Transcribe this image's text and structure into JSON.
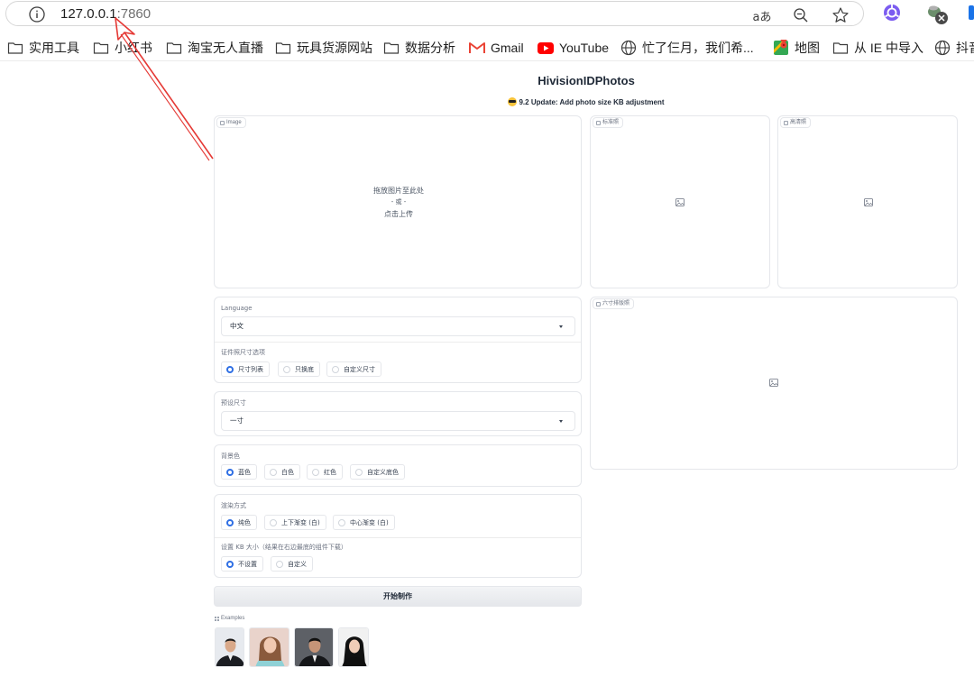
{
  "browser": {
    "url_host": "127.0.0.1",
    "url_port": ":7860",
    "translate_label": "aあ",
    "ext_badge": "X"
  },
  "bookmarks": [
    {
      "label": "实用工具",
      "icon": "folder-icon"
    },
    {
      "label": "小红书",
      "icon": "folder-icon"
    },
    {
      "label": "淘宝无人直播",
      "icon": "folder-icon"
    },
    {
      "label": "玩具货源网站",
      "icon": "folder-icon"
    },
    {
      "label": "数据分析",
      "icon": "folder-icon"
    },
    {
      "label": "Gmail",
      "icon": "gmail-icon"
    },
    {
      "label": "YouTube",
      "icon": "youtube-icon"
    },
    {
      "label": "忙了仨月，我们希...",
      "icon": "globe-icon"
    },
    {
      "label": "地图",
      "icon": "maps-icon"
    },
    {
      "label": "从 IE 中导入",
      "icon": "folder-icon"
    },
    {
      "label": "抖音",
      "icon": "globe-icon"
    }
  ],
  "app": {
    "title": "HivisionIDPhotos",
    "subtitle": "9.2 Update: Add photo size KB adjustment"
  },
  "image_input": {
    "tag": "Image",
    "line1": "拖放图片至此处",
    "line2": "- 或 -",
    "line3": "点击上传"
  },
  "outputs": {
    "standard_tag": "标准照",
    "hd_tag": "高清照",
    "layout_tag": "六寸排版照"
  },
  "form": {
    "language_label": "Language",
    "language_value": "中文",
    "size_option_label": "证件照尺寸选项",
    "size_options": [
      "尺寸列表",
      "只换底",
      "自定义尺寸"
    ],
    "size_selected": 0,
    "preset_label": "预设尺寸",
    "preset_value": "一寸",
    "bg_label": "背景色",
    "bg_options": [
      "蓝色",
      "白色",
      "红色",
      "自定义底色"
    ],
    "bg_selected": 0,
    "render_label": "渲染方式",
    "render_options": [
      "纯色",
      "上下渐变 (白)",
      "中心渐变 (白)"
    ],
    "render_selected": 0,
    "kb_label": "设置 KB 大小（结果在右边最底的组件下载）",
    "kb_options": [
      "不设置",
      "自定义"
    ],
    "kb_selected": 0,
    "start_button": "开始制作"
  },
  "examples": {
    "label": "Examples",
    "items": [
      "example-photo-1",
      "example-photo-2",
      "example-photo-3",
      "example-photo-4"
    ]
  },
  "colors": {
    "accent_blue": "#2f6fe4",
    "annotation_red": "#e53935",
    "ext_purple": "#7b5cf0"
  }
}
